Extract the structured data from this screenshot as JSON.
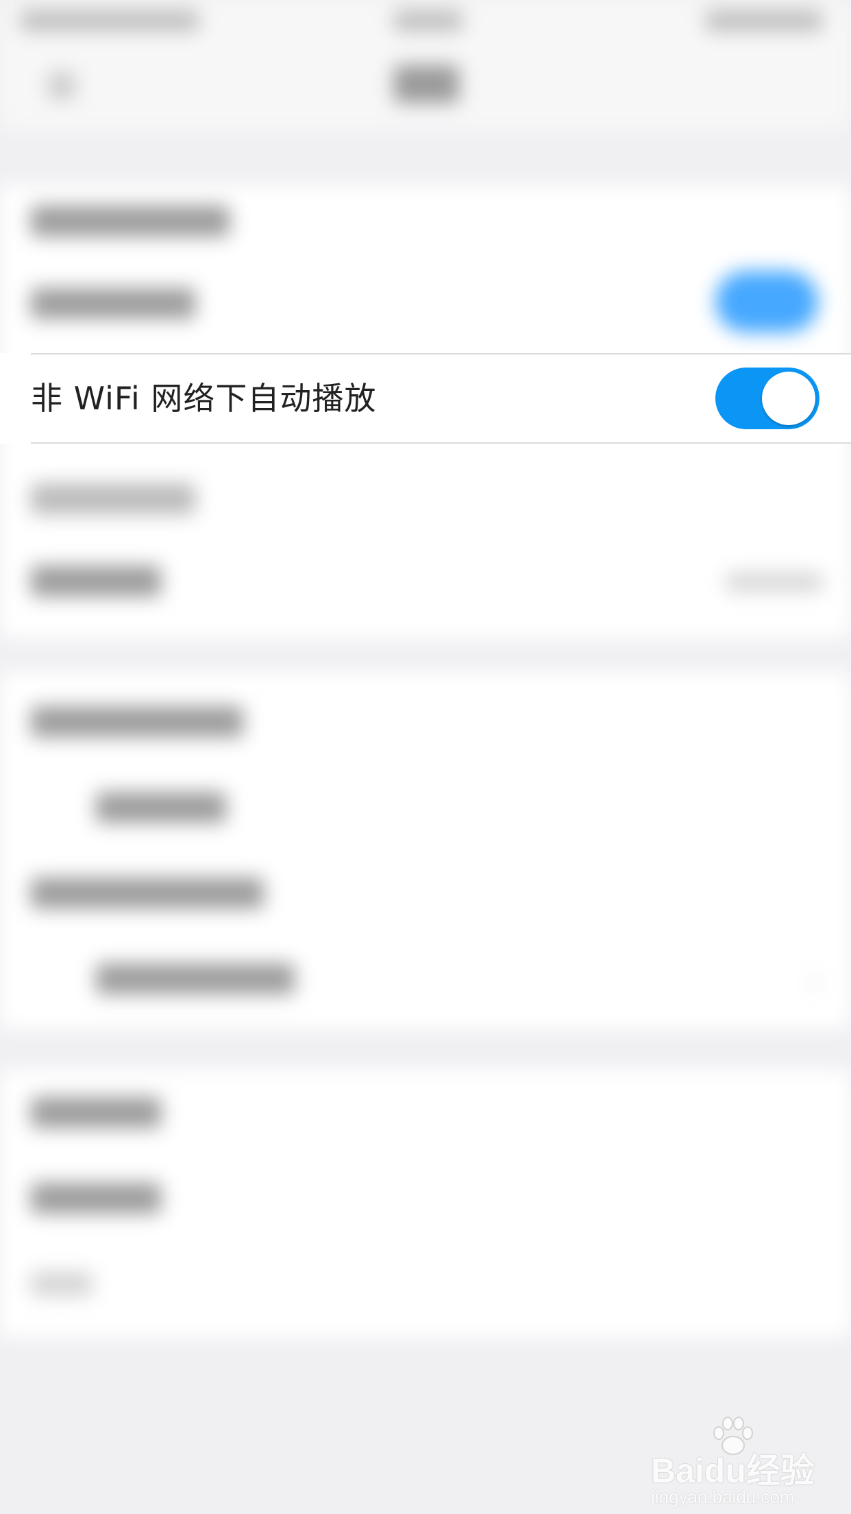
{
  "setting_row": {
    "label": "非 WiFi 网络下自动播放",
    "toggle_state": "on"
  },
  "colors": {
    "toggle_on": "#0b96f6",
    "page_background": "#f0f0f3",
    "row_background": "#ffffff"
  },
  "watermark": {
    "logo_text": "Baidu经验",
    "url": "jingyan.baidu.com"
  }
}
